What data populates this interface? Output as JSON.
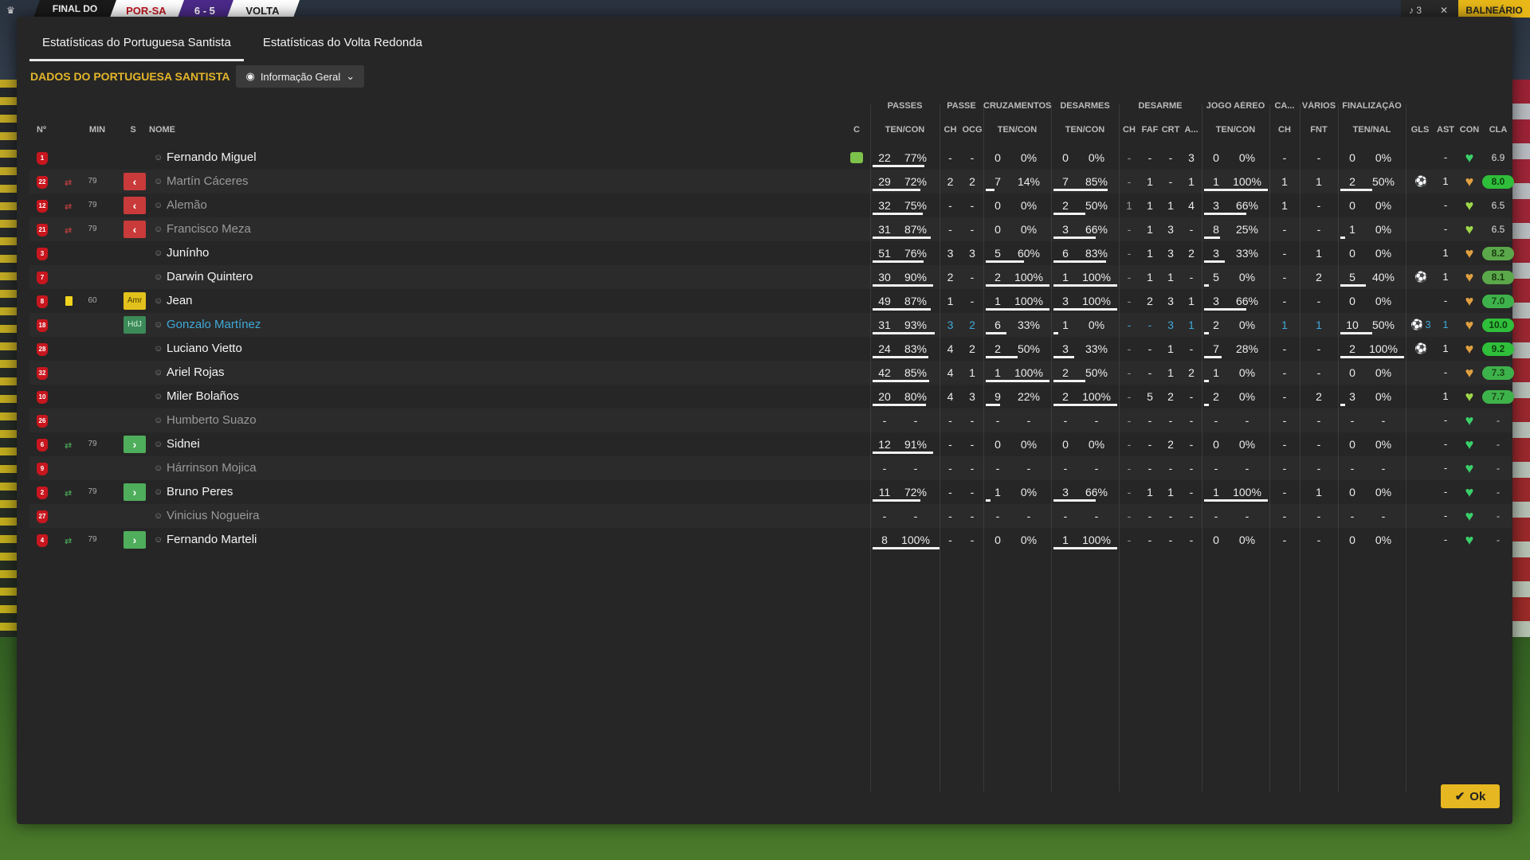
{
  "topbar": {
    "final_label": "FINAL DO",
    "home": "POR-SA",
    "score": "6 - 5",
    "away": "VOLTA",
    "btn1": "♪ 3",
    "btn2": "✕",
    "balneario": "BALNEÁRIO"
  },
  "tabs": [
    "Estatísticas do Portuguesa Santista",
    "Estatísticas do Volta Redonda"
  ],
  "section_title": "DADOS DO PORTUGUESA SANTISTA",
  "view_dropdown": "Informação Geral",
  "groups": [
    "PASSES",
    "PASSE",
    "CRUZAMENTOS",
    "DESARMES",
    "DESARME",
    "JOGO AÉREO",
    "CA...",
    "VÁRIOS",
    "FINALIZAÇÃO"
  ],
  "headers": {
    "no": "Nº",
    "min": "MIN",
    "s": "S",
    "nome": "NOME",
    "c": "C",
    "passes": "TEN/CON",
    "passe_ch": "CH",
    "passe_ocg": "OCG",
    "cruz": "TEN/CON",
    "desarmes": "TEN/CON",
    "des_ch": "CH",
    "des_faf": "FAF",
    "des_crt": "CRT",
    "des_a": "A...",
    "aereo": "TEN/CON",
    "ca_ch": "CH",
    "var_fnt": "FNT",
    "final": "TEN/NAL",
    "gls": "GLS",
    "ast": "AST",
    "con": "CON",
    "cla": "CLA"
  },
  "players": [
    {
      "no": "1",
      "min": "",
      "s": "",
      "name": "Fernando Miguel",
      "dim": false,
      "hl": false,
      "kit": true,
      "card": "",
      "pt": "22",
      "pp": "77%",
      "pf": 0.77,
      "pch": "-",
      "pocg": "-",
      "ct": "0",
      "cp": "0%",
      "cf": 0,
      "dt": "0",
      "dp": "0%",
      "df": 0,
      "dch": "-",
      "dfaf": "-",
      "dcrt": "-",
      "da": "3",
      "at": "0",
      "ap": "0%",
      "af": 0,
      "cach": "-",
      "fnt": "-",
      "ft": "0",
      "fp": "0%",
      "ff": 0,
      "gls": "",
      "ast": "-",
      "heart": "green",
      "cla": "6.9",
      "clas": "plain",
      "sub": ""
    },
    {
      "no": "22",
      "min": "79",
      "s": "out",
      "name": "Martín Cáceres",
      "dim": true,
      "hl": false,
      "kit": false,
      "card": "",
      "pt": "29",
      "pp": "72%",
      "pf": 0.72,
      "pch": "2",
      "pocg": "2",
      "ct": "7",
      "cp": "14%",
      "cf": 0.14,
      "dt": "7",
      "dp": "85%",
      "df": 0.85,
      "dch": "-",
      "dfaf": "1",
      "dcrt": "-",
      "da": "1",
      "at": "1",
      "ap": "100%",
      "af": 1,
      "cach": "1",
      "fnt": "1",
      "ft": "2",
      "fp": "50%",
      "ff": 0.5,
      "gls": "gear",
      "ast": "1",
      "heart": "orange",
      "cla": "8.0",
      "clas": "g3",
      "sub": "out"
    },
    {
      "no": "12",
      "min": "79",
      "s": "out",
      "name": "Alemão",
      "dim": true,
      "hl": false,
      "kit": false,
      "card": "",
      "pt": "32",
      "pp": "75%",
      "pf": 0.75,
      "pch": "-",
      "pocg": "-",
      "ct": "0",
      "cp": "0%",
      "cf": 0,
      "dt": "2",
      "dp": "50%",
      "df": 0.5,
      "dch": "1",
      "dfaf": "1",
      "dcrt": "1",
      "da": "4",
      "at": "3",
      "ap": "66%",
      "af": 0.66,
      "cach": "1",
      "fnt": "-",
      "ft": "0",
      "fp": "0%",
      "ff": 0,
      "gls": "",
      "ast": "-",
      "heart": "lime",
      "cla": "6.5",
      "clas": "plain",
      "sub": "out"
    },
    {
      "no": "21",
      "min": "79",
      "s": "out",
      "name": "Francisco Meza",
      "dim": true,
      "hl": false,
      "kit": false,
      "card": "",
      "pt": "31",
      "pp": "87%",
      "pf": 0.87,
      "pch": "-",
      "pocg": "-",
      "ct": "0",
      "cp": "0%",
      "cf": 0,
      "dt": "3",
      "dp": "66%",
      "df": 0.66,
      "dch": "-",
      "dfaf": "1",
      "dcrt": "3",
      "da": "-",
      "at": "8",
      "ap": "25%",
      "af": 0.25,
      "cach": "-",
      "fnt": "-",
      "ft": "1",
      "fp": "0%",
      "ff": 0,
      "gls": "",
      "ast": "-",
      "heart": "lime",
      "cla": "6.5",
      "clas": "plain",
      "sub": "out"
    },
    {
      "no": "3",
      "min": "",
      "s": "",
      "name": "Junínho",
      "dim": false,
      "hl": false,
      "kit": false,
      "card": "",
      "pt": "51",
      "pp": "76%",
      "pf": 0.76,
      "pch": "3",
      "pocg": "3",
      "ct": "5",
      "cp": "60%",
      "cf": 0.6,
      "dt": "6",
      "dp": "83%",
      "df": 0.83,
      "dch": "-",
      "dfaf": "1",
      "dcrt": "3",
      "da": "2",
      "at": "3",
      "ap": "33%",
      "af": 0.33,
      "cach": "-",
      "fnt": "1",
      "ft": "0",
      "fp": "0%",
      "ff": 0,
      "gls": "",
      "ast": "1",
      "heart": "orange",
      "cla": "8.2",
      "clas": "g2",
      "sub": ""
    },
    {
      "no": "7",
      "min": "",
      "s": "",
      "name": "Darwin Quintero",
      "dim": false,
      "hl": false,
      "kit": false,
      "card": "",
      "pt": "30",
      "pp": "90%",
      "pf": 0.9,
      "pch": "2",
      "pocg": "-",
      "ct": "2",
      "cp": "100%",
      "cf": 1,
      "dt": "1",
      "dp": "100%",
      "df": 1,
      "dch": "-",
      "dfaf": "1",
      "dcrt": "1",
      "da": "-",
      "at": "5",
      "ap": "0%",
      "af": 0,
      "cach": "-",
      "fnt": "2",
      "ft": "5",
      "fp": "40%",
      "ff": 0.4,
      "gls": "gear",
      "ast": "1",
      "heart": "orange",
      "cla": "8.1",
      "clas": "g2",
      "sub": ""
    },
    {
      "no": "8",
      "min": "60",
      "s": "amr",
      "name": "Jean",
      "dim": false,
      "hl": false,
      "kit": false,
      "card": "yellow",
      "pt": "49",
      "pp": "87%",
      "pf": 0.87,
      "pch": "1",
      "pocg": "-",
      "ct": "1",
      "cp": "100%",
      "cf": 1,
      "dt": "3",
      "dp": "100%",
      "df": 1,
      "dch": "-",
      "dfaf": "2",
      "dcrt": "3",
      "da": "1",
      "at": "3",
      "ap": "66%",
      "af": 0.66,
      "cach": "-",
      "fnt": "-",
      "ft": "0",
      "fp": "0%",
      "ff": 0,
      "gls": "",
      "ast": "-",
      "heart": "orange",
      "cla": "7.0",
      "clas": "g1",
      "sub": ""
    },
    {
      "no": "18",
      "min": "",
      "s": "hdj",
      "name": "Gonzalo Martínez",
      "dim": false,
      "hl": true,
      "kit": false,
      "card": "",
      "pt": "31",
      "pp": "93%",
      "pf": 0.93,
      "pch": "3",
      "pocg": "2",
      "ct": "6",
      "cp": "33%",
      "cf": 0.33,
      "dt": "1",
      "dp": "0%",
      "df": 0,
      "dch": "-",
      "dfaf": "-",
      "dcrt": "3",
      "da": "1",
      "at": "2",
      "ap": "0%",
      "af": 0,
      "cach": "1",
      "fnt": "1",
      "ft": "10",
      "fp": "50%",
      "ff": 0.5,
      "gls": "gear3",
      "ast": "1",
      "heart": "orange",
      "cla": "10.0",
      "clas": "g3",
      "sub": ""
    },
    {
      "no": "28",
      "min": "",
      "s": "",
      "name": "Luciano Vietto",
      "dim": false,
      "hl": false,
      "kit": false,
      "card": "",
      "pt": "24",
      "pp": "83%",
      "pf": 0.83,
      "pch": "4",
      "pocg": "2",
      "ct": "2",
      "cp": "50%",
      "cf": 0.5,
      "dt": "3",
      "dp": "33%",
      "df": 0.33,
      "dch": "-",
      "dfaf": "-",
      "dcrt": "1",
      "da": "-",
      "at": "7",
      "ap": "28%",
      "af": 0.28,
      "cach": "-",
      "fnt": "-",
      "ft": "2",
      "fp": "100%",
      "ff": 1,
      "gls": "gear",
      "ast": "1",
      "heart": "orange",
      "cla": "9.2",
      "clas": "g3",
      "sub": ""
    },
    {
      "no": "32",
      "min": "",
      "s": "",
      "name": "Ariel Rojas",
      "dim": false,
      "hl": false,
      "kit": false,
      "card": "",
      "pt": "42",
      "pp": "85%",
      "pf": 0.85,
      "pch": "4",
      "pocg": "1",
      "ct": "1",
      "cp": "100%",
      "cf": 1,
      "dt": "2",
      "dp": "50%",
      "df": 0.5,
      "dch": "-",
      "dfaf": "-",
      "dcrt": "1",
      "da": "2",
      "at": "1",
      "ap": "0%",
      "af": 0,
      "cach": "-",
      "fnt": "-",
      "ft": "0",
      "fp": "0%",
      "ff": 0,
      "gls": "",
      "ast": "-",
      "heart": "orange",
      "cla": "7.3",
      "clas": "g1",
      "sub": ""
    },
    {
      "no": "10",
      "min": "",
      "s": "",
      "name": "Miler Bolaños",
      "dim": false,
      "hl": false,
      "kit": false,
      "card": "",
      "pt": "20",
      "pp": "80%",
      "pf": 0.8,
      "pch": "4",
      "pocg": "3",
      "ct": "9",
      "cp": "22%",
      "cf": 0.22,
      "dt": "2",
      "dp": "100%",
      "df": 1,
      "dch": "-",
      "dfaf": "5",
      "dcrt": "2",
      "da": "-",
      "at": "2",
      "ap": "0%",
      "af": 0,
      "cach": "-",
      "fnt": "2",
      "ft": "3",
      "fp": "0%",
      "ff": 0,
      "gls": "",
      "ast": "1",
      "heart": "lime",
      "cla": "7.7",
      "clas": "g1",
      "sub": ""
    },
    {
      "no": "26",
      "min": "",
      "s": "",
      "name": "Humberto Suazo",
      "dim": true,
      "hl": false,
      "kit": false,
      "card": "",
      "pt": "-",
      "pp": "-",
      "pf": 0,
      "pch": "-",
      "pocg": "-",
      "ct": "-",
      "cp": "-",
      "cf": 0,
      "dt": "-",
      "dp": "-",
      "df": 0,
      "dch": "-",
      "dfaf": "-",
      "dcrt": "-",
      "da": "-",
      "at": "-",
      "ap": "-",
      "af": 0,
      "cach": "-",
      "fnt": "-",
      "ft": "-",
      "fp": "-",
      "ff": 0,
      "gls": "",
      "ast": "-",
      "heart": "green",
      "cla": "-",
      "clas": "plain",
      "sub": ""
    },
    {
      "no": "6",
      "min": "79",
      "s": "in",
      "name": "Sidnei",
      "dim": false,
      "hl": false,
      "kit": false,
      "card": "",
      "pt": "12",
      "pp": "91%",
      "pf": 0.91,
      "pch": "-",
      "pocg": "-",
      "ct": "0",
      "cp": "0%",
      "cf": 0,
      "dt": "0",
      "dp": "0%",
      "df": 0,
      "dch": "-",
      "dfaf": "-",
      "dcrt": "2",
      "da": "-",
      "at": "0",
      "ap": "0%",
      "af": 0,
      "cach": "-",
      "fnt": "-",
      "ft": "0",
      "fp": "0%",
      "ff": 0,
      "gls": "",
      "ast": "-",
      "heart": "green",
      "cla": "-",
      "clas": "plain",
      "sub": "in"
    },
    {
      "no": "9",
      "min": "",
      "s": "",
      "name": "Hárrinson Mojica",
      "dim": true,
      "hl": false,
      "kit": false,
      "card": "",
      "pt": "-",
      "pp": "-",
      "pf": 0,
      "pch": "-",
      "pocg": "-",
      "ct": "-",
      "cp": "-",
      "cf": 0,
      "dt": "-",
      "dp": "-",
      "df": 0,
      "dch": "-",
      "dfaf": "-",
      "dcrt": "-",
      "da": "-",
      "at": "-",
      "ap": "-",
      "af": 0,
      "cach": "-",
      "fnt": "-",
      "ft": "-",
      "fp": "-",
      "ff": 0,
      "gls": "",
      "ast": "-",
      "heart": "green",
      "cla": "-",
      "clas": "plain",
      "sub": ""
    },
    {
      "no": "2",
      "min": "79",
      "s": "in",
      "name": "Bruno Peres",
      "dim": false,
      "hl": false,
      "kit": false,
      "card": "",
      "pt": "11",
      "pp": "72%",
      "pf": 0.72,
      "pch": "-",
      "pocg": "-",
      "ct": "1",
      "cp": "0%",
      "cf": 0,
      "dt": "3",
      "dp": "66%",
      "df": 0.66,
      "dch": "-",
      "dfaf": "1",
      "dcrt": "1",
      "da": "-",
      "at": "1",
      "ap": "100%",
      "af": 1,
      "cach": "-",
      "fnt": "1",
      "ft": "0",
      "fp": "0%",
      "ff": 0,
      "gls": "",
      "ast": "-",
      "heart": "green",
      "cla": "-",
      "clas": "plain",
      "sub": "in"
    },
    {
      "no": "27",
      "min": "",
      "s": "",
      "name": "Vinicius Nogueira",
      "dim": true,
      "hl": false,
      "kit": false,
      "card": "",
      "pt": "-",
      "pp": "-",
      "pf": 0,
      "pch": "-",
      "pocg": "-",
      "ct": "-",
      "cp": "-",
      "cf": 0,
      "dt": "-",
      "dp": "-",
      "df": 0,
      "dch": "-",
      "dfaf": "-",
      "dcrt": "-",
      "da": "-",
      "at": "-",
      "ap": "-",
      "af": 0,
      "cach": "-",
      "fnt": "-",
      "ft": "-",
      "fp": "-",
      "ff": 0,
      "gls": "",
      "ast": "-",
      "heart": "green",
      "cla": "-",
      "clas": "plain",
      "sub": ""
    },
    {
      "no": "4",
      "min": "79",
      "s": "in",
      "name": "Fernando Marteli",
      "dim": false,
      "hl": false,
      "kit": false,
      "card": "",
      "pt": "8",
      "pp": "100%",
      "pf": 1,
      "pch": "-",
      "pocg": "-",
      "ct": "0",
      "cp": "0%",
      "cf": 0,
      "dt": "1",
      "dp": "100%",
      "df": 1,
      "dch": "-",
      "dfaf": "-",
      "dcrt": "-",
      "da": "-",
      "at": "0",
      "ap": "0%",
      "af": 0,
      "cach": "-",
      "fnt": "-",
      "ft": "0",
      "fp": "0%",
      "ff": 0,
      "gls": "",
      "ast": "-",
      "heart": "green",
      "cla": "-",
      "clas": "plain",
      "sub": "in"
    }
  ],
  "ok_label": "Ok",
  "colors": {
    "accent": "#e6b720",
    "home_red": "#c8161e",
    "green": "#3eb24a",
    "highlight": "#40a8d8"
  }
}
